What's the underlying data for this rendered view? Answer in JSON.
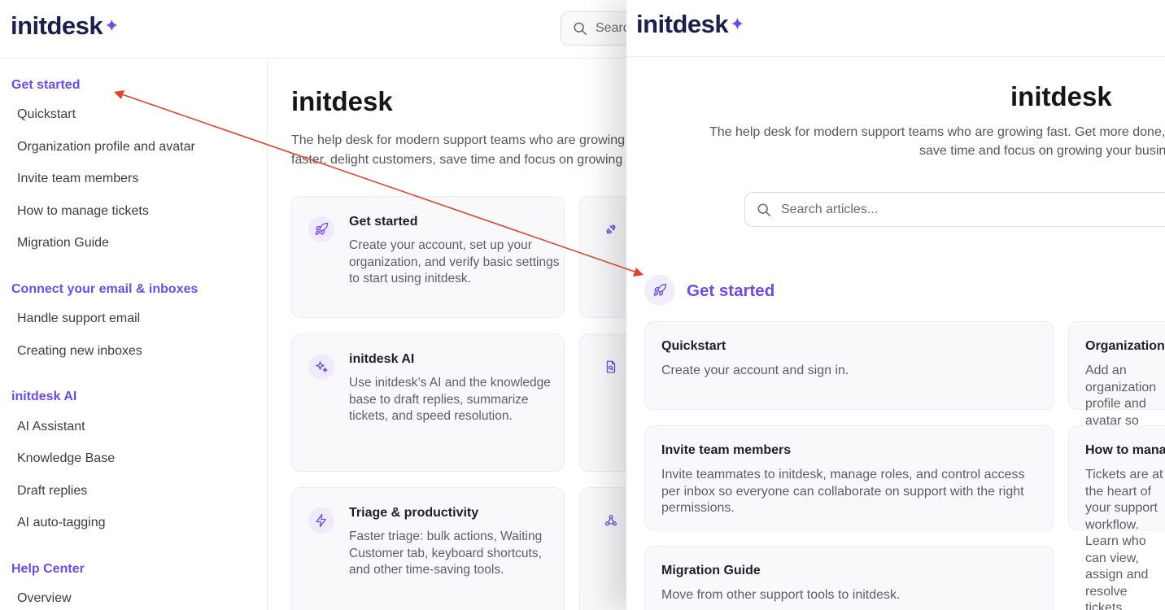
{
  "left": {
    "logo": "initdesk",
    "search_placeholder": "Search",
    "sidebar": {
      "sections": [
        {
          "title": "Get started",
          "items": [
            "Quickstart",
            "Organization profile and avatar",
            "Invite team members",
            "How to manage tickets",
            "Migration Guide"
          ]
        },
        {
          "title": "Connect your email & inboxes",
          "items": [
            "Handle support email",
            "Creating new inboxes"
          ]
        },
        {
          "title": "initdesk AI",
          "items": [
            "AI Assistant",
            "Knowledge Base",
            "Draft replies",
            "AI auto-tagging"
          ]
        },
        {
          "title": "Help Center",
          "items": [
            "Overview"
          ]
        }
      ]
    },
    "main": {
      "title": "initdesk",
      "desc_line1": "The help desk for modern support teams who are growing fast. Get more done,",
      "desc_line2": "faster, delight customers, save time and focus on growing your business.",
      "cards": [
        {
          "title": "Get started",
          "desc": "Create your account, set up your organization, and verify basic settings to start using initdesk.",
          "icon": "rocket-icon"
        },
        {
          "title": "initdesk AI",
          "desc": "Use initdesk’s AI and the knowledge base to draft replies, summarize tickets, and speed resolution.",
          "icon": "sparkle-icon"
        },
        {
          "title": "Triage & productivity",
          "desc": "Faster triage: bulk actions, Waiting Customer tab, keyboard shortcuts, and other time-saving tools.",
          "icon": "lightning-icon"
        }
      ],
      "peek_card_icons": [
        "plug-icon",
        "document-search-icon",
        "webhook-icon"
      ]
    }
  },
  "right": {
    "logo": "initdesk",
    "title": "initdesk",
    "desc_line1": "The help desk for modern support teams who are growing fast. Get more done, faster, delight customers,",
    "desc_line2": "save time and focus on growing your business.",
    "search_placeholder": "Search articles...",
    "section": {
      "title": "Get started",
      "icon": "rocket-icon"
    },
    "cards": [
      {
        "title": "Quickstart",
        "desc": "Create your account and sign in."
      },
      {
        "title": "Organization profile and avatar",
        "desc": "Add an organization profile and avatar so customers recognize your organization."
      },
      {
        "title": "Invite team members",
        "desc": "Invite teammates to initdesk, manage roles, and control access per inbox so everyone can collaborate on support with the right permissions."
      },
      {
        "title": "How to manage tickets",
        "desc": "Tickets are at the heart of your support workflow. Learn who can view, assign and resolve tickets."
      },
      {
        "title": "Migration Guide",
        "desc": "Move from other support tools to initdesk."
      }
    ]
  },
  "annotation": {
    "type": "arrow",
    "color": "#e0442c"
  },
  "colors": {
    "accent": "#6c4de6",
    "logo_text": "#1b1f4b",
    "card_bg": "#f9f9fb",
    "border": "#ececf1"
  }
}
